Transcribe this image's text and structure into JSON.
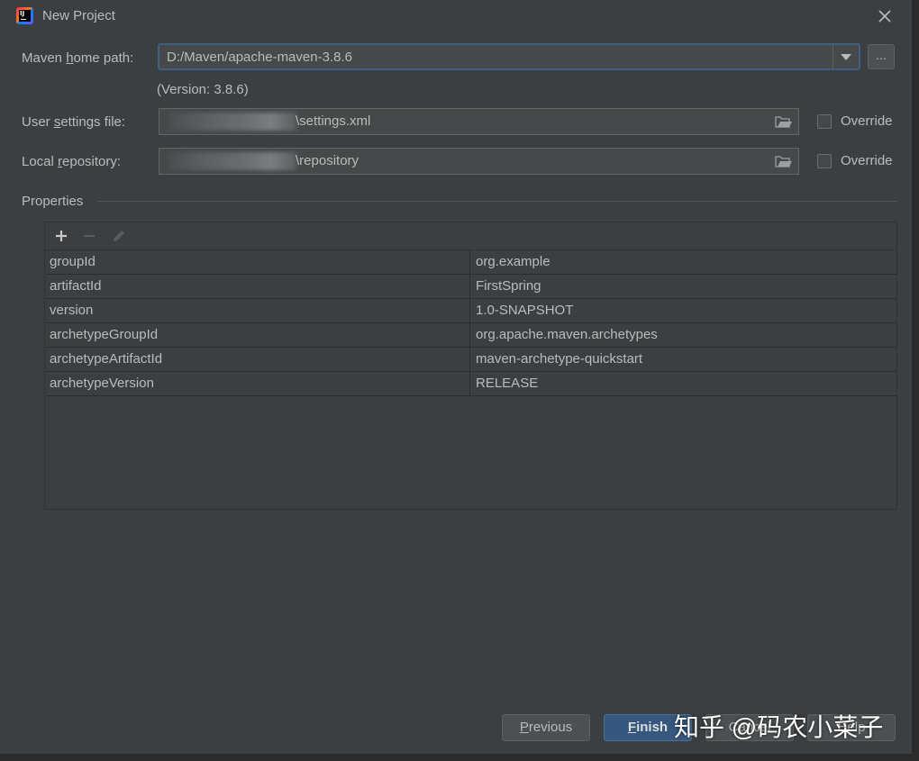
{
  "window": {
    "title": "New Project"
  },
  "maven_home": {
    "label_pre": "Maven ",
    "label_mnemonic": "h",
    "label_post": "ome path:",
    "value": "D:/Maven/apache-maven-3.8.6",
    "browse_label": "...",
    "version_text": "(Version: 3.8.6)"
  },
  "user_settings": {
    "label_pre": "User ",
    "label_mnemonic": "s",
    "label_post": "ettings file:",
    "value": "\\settings.xml",
    "override_label": "Override"
  },
  "local_repo": {
    "label_pre": "Local ",
    "label_mnemonic": "r",
    "label_post": "epository:",
    "value": "\\repository",
    "override_label": "Override"
  },
  "properties": {
    "section_label": "Properties",
    "rows": [
      {
        "key": "groupId",
        "value": "org.example"
      },
      {
        "key": "artifactId",
        "value": "FirstSpring"
      },
      {
        "key": "version",
        "value": "1.0-SNAPSHOT"
      },
      {
        "key": "archetypeGroupId",
        "value": "org.apache.maven.archetypes"
      },
      {
        "key": "archetypeArtifactId",
        "value": "maven-archetype-quickstart"
      },
      {
        "key": "archetypeVersion",
        "value": "RELEASE"
      }
    ]
  },
  "buttons": {
    "previous_mnemonic": "P",
    "previous_rest": "revious",
    "finish_mnemonic": "F",
    "finish_rest": "inish",
    "cancel": "Cancel",
    "help": "Help"
  },
  "watermark": {
    "text": "知乎 @码农小菜子"
  },
  "colors": {
    "background": "#3c3f41",
    "focus_border": "#3d6185",
    "default_button": "#365880",
    "text": "#bbbbbb"
  }
}
